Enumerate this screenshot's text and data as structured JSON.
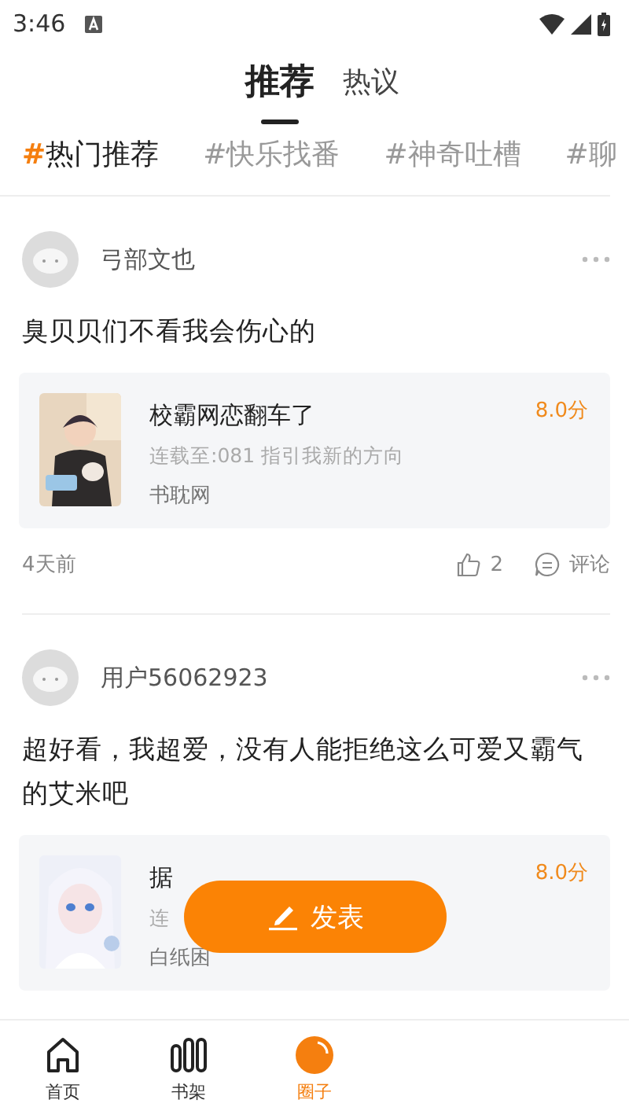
{
  "status_bar": {
    "time": "3:46"
  },
  "top_tabs": [
    {
      "label": "推荐",
      "selected": true
    },
    {
      "label": "热议",
      "selected": false
    }
  ],
  "topics": [
    {
      "hash": "#",
      "label": "热门推荐",
      "selected": true
    },
    {
      "hash": "#",
      "label": "快乐找番",
      "selected": false
    },
    {
      "hash": "#",
      "label": "神奇吐槽",
      "selected": false
    },
    {
      "hash": "#",
      "label": "聊",
      "selected": false
    }
  ],
  "posts": [
    {
      "user": "弓部文也",
      "text": "臭贝贝们不看我会伤心的",
      "book": {
        "title": "校霸网恋翻车了",
        "subtitle": "连载至:081 指引我新的方向",
        "source": "书耽网",
        "score": "8.0分"
      },
      "time": "4天前",
      "likes": "2",
      "comment": "评论"
    },
    {
      "user": "用户56062923",
      "text": "超好看，我超爱，没有人能拒绝这么可爱又霸气的艾米吧",
      "book": {
        "title": "据",
        "subtitle": "连",
        "source": "白纸困",
        "score": "8.0分"
      }
    }
  ],
  "fab": {
    "label": "发表"
  },
  "nav": [
    {
      "label": "首页",
      "selected": false
    },
    {
      "label": "书架",
      "selected": false
    },
    {
      "label": "圈子",
      "selected": true
    }
  ]
}
